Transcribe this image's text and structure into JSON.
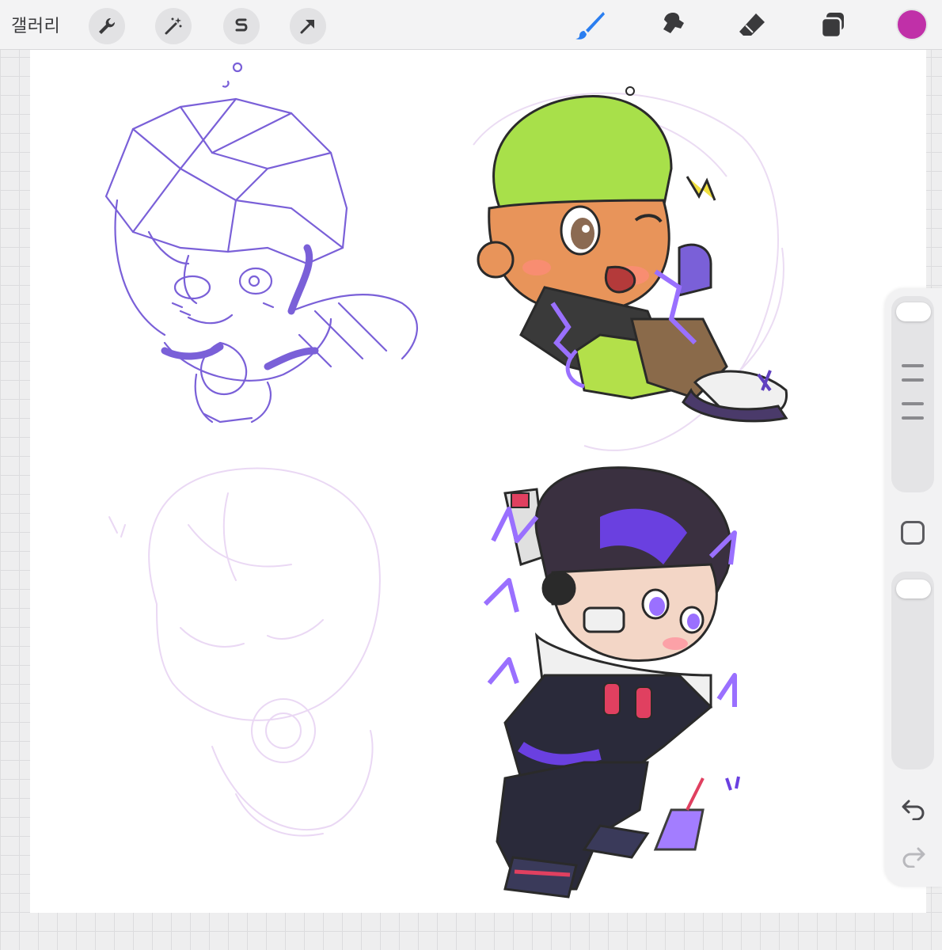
{
  "toolbar": {
    "gallery_label": "갤러리",
    "left_tools": [
      "wrench-icon",
      "magic-wand-icon",
      "selection-icon",
      "transform-arrow-icon"
    ],
    "right_tools": [
      "brush-icon",
      "smudge-icon",
      "eraser-icon",
      "layers-icon"
    ],
    "active_tool": "brush-icon",
    "current_color": "#c030a8",
    "accent_color": "#2a7ef0"
  },
  "canvas": {
    "background": "#ffffff",
    "sketch_color": "#7a60d8",
    "faint_sketch_color": "#ead8f4"
  },
  "sidebar": {
    "brush_size_slider": "slider-thumb",
    "opacity_slider": "slider-thumb",
    "modify_button": "square-icon",
    "undo": "undo-icon",
    "redo": "redo-icon"
  }
}
